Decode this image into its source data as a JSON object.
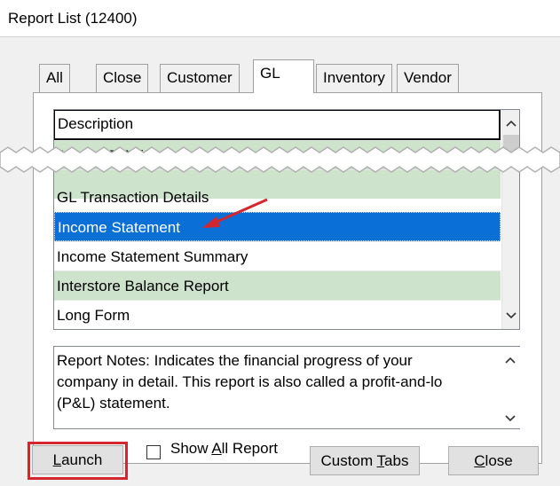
{
  "window": {
    "title": "Report List (12400)"
  },
  "tabs": [
    {
      "label": "All",
      "active": false
    },
    {
      "label": "Close",
      "active": false
    },
    {
      "label": "Customer",
      "active": false
    },
    {
      "label": "GL",
      "active": true
    },
    {
      "label": "Inventory",
      "active": false
    },
    {
      "label": "Vendor",
      "active": false
    }
  ],
  "list": {
    "header": "Description",
    "rows_top": [
      {
        "label": "AR or AP Aging",
        "style": "green"
      }
    ],
    "rows_bottom": [
      {
        "label": "GL Transaction Details",
        "style": "white"
      },
      {
        "label": "Income Statement",
        "style": "selected"
      },
      {
        "label": "Income Statement Summary",
        "style": "white"
      },
      {
        "label": "Interstore Balance Report",
        "style": "green"
      },
      {
        "label": "Long Form",
        "style": "white"
      }
    ]
  },
  "notes": {
    "text": "Report Notes:  Indicates the financial progress of your\ncompany in detail. This report is also called a profit-and-lo\n(P&L) statement."
  },
  "controls": {
    "launch_pre": "",
    "launch_u": "L",
    "launch_post": "aunch",
    "show_all_pre": "Show ",
    "show_all_u": "A",
    "show_all_post": "ll Report",
    "show_all_checked": false,
    "custom_tabs_pre": "Custom ",
    "custom_tabs_u": "T",
    "custom_tabs_post": "abs",
    "close_pre": "",
    "close_u": "C",
    "close_post": "lose"
  },
  "colors": {
    "green_row": "#cde3cc",
    "selected_row": "#0a6fd6",
    "annotation_red": "#d3262f"
  },
  "icons": {
    "scroll_up": "chevron-up-icon",
    "scroll_down": "chevron-down-icon",
    "annotation": "red-arrow-icon"
  }
}
